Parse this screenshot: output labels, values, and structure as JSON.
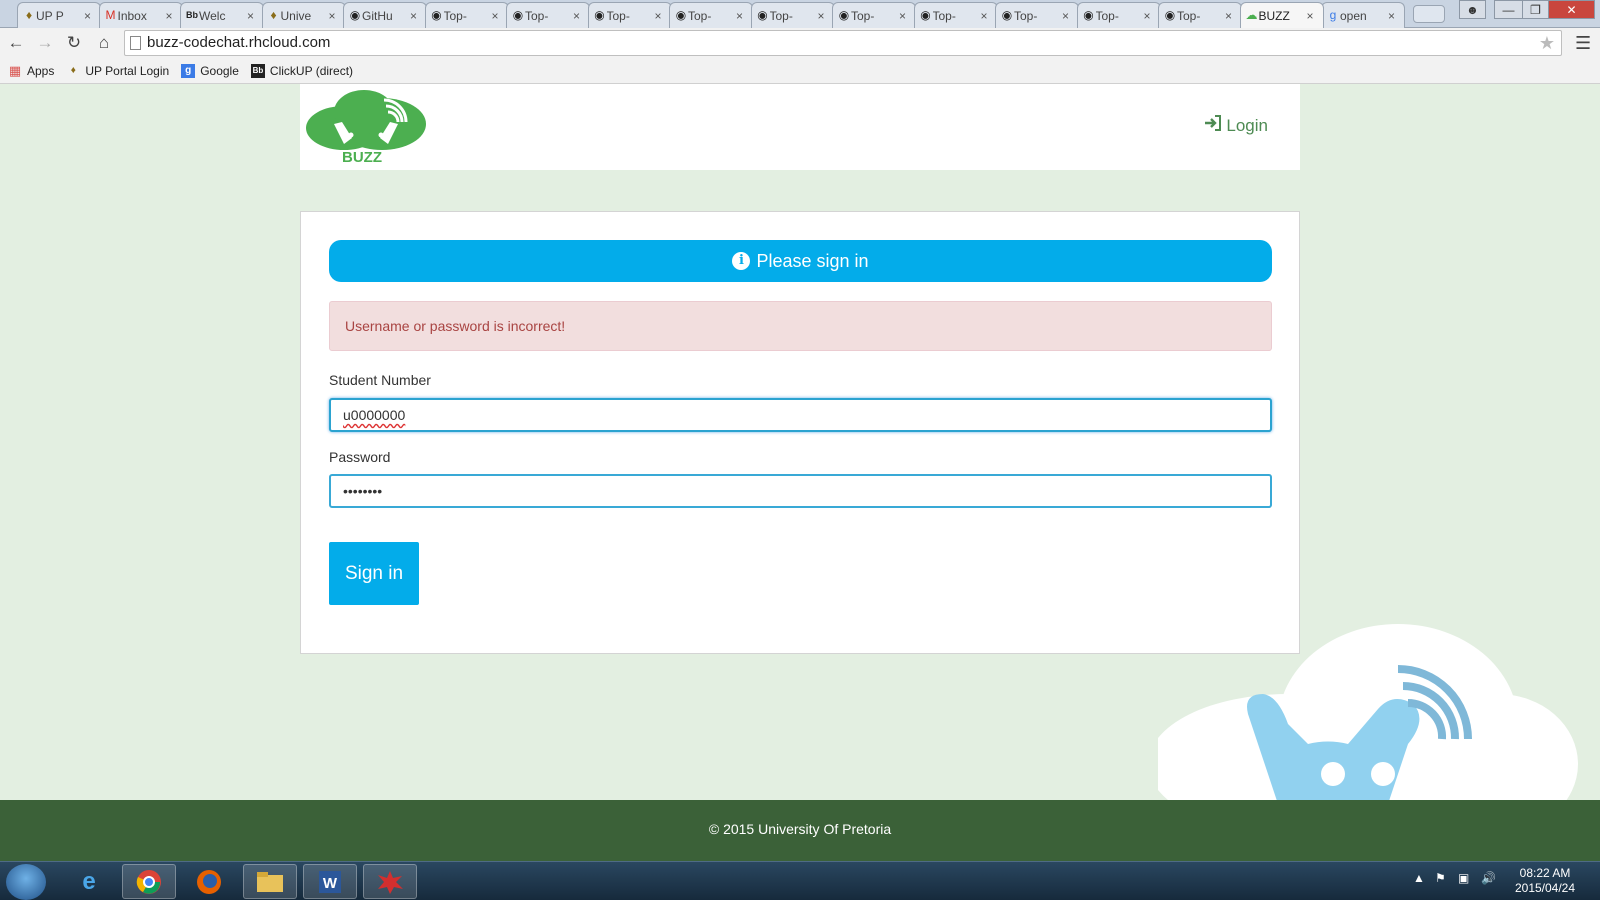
{
  "browser": {
    "tabs": [
      {
        "label": "UP P",
        "icon": "up-crest-icon"
      },
      {
        "label": "Inbox",
        "icon": "gmail-icon"
      },
      {
        "label": "Welc",
        "icon": "blackboard-icon"
      },
      {
        "label": "Unive",
        "icon": "up-crest-icon"
      },
      {
        "label": "GitHu",
        "icon": "github-icon"
      },
      {
        "label": "Top-",
        "icon": "github-icon"
      },
      {
        "label": "Top-",
        "icon": "github-icon"
      },
      {
        "label": "Top-",
        "icon": "github-icon"
      },
      {
        "label": "Top-",
        "icon": "github-icon"
      },
      {
        "label": "Top-",
        "icon": "github-icon"
      },
      {
        "label": "Top-",
        "icon": "github-icon"
      },
      {
        "label": "Top-",
        "icon": "github-icon"
      },
      {
        "label": "Top-",
        "icon": "github-icon"
      },
      {
        "label": "Top-",
        "icon": "github-icon"
      },
      {
        "label": "Top-",
        "icon": "github-icon"
      },
      {
        "label": "BUZZ",
        "icon": "buzz-icon",
        "active": true
      },
      {
        "label": "open",
        "icon": "google-icon"
      }
    ],
    "close_glyph": "×",
    "url": "buzz-codechat.rhcloud.com",
    "bookmarks": [
      {
        "label": "Apps",
        "icon": "apps-grid-icon"
      },
      {
        "label": "UP Portal Login",
        "icon": "up-crest-icon"
      },
      {
        "label": "Google",
        "icon": "google-icon"
      },
      {
        "label": "ClickUP (direct)",
        "icon": "blackboard-icon"
      }
    ]
  },
  "header": {
    "logo_text": "BUZZ",
    "login_label": "Login"
  },
  "form": {
    "banner_text": "Please sign in",
    "error_text": "Username or password is incorrect!",
    "student_number_label": "Student Number",
    "student_number_value": "u0000000",
    "password_label": "Password",
    "password_value": "••••••••",
    "submit_label": "Sign in"
  },
  "footer": {
    "text": "© 2015 University Of Pretoria"
  },
  "taskbar": {
    "apps": [
      {
        "name": "internet-explorer",
        "icon": "internet-explorer-icon"
      },
      {
        "name": "chrome",
        "icon": "chrome-icon"
      },
      {
        "name": "firefox",
        "icon": "firefox-icon"
      },
      {
        "name": "file-explorer",
        "icon": "folder-icon"
      },
      {
        "name": "word",
        "icon": "word-icon"
      },
      {
        "name": "app",
        "icon": "red-splat-icon"
      }
    ],
    "clock_time": "08:22 AM",
    "clock_date": "2015/04/24"
  },
  "colors": {
    "accent": "#03acea",
    "brand_green": "#4caf50",
    "footer_bg": "#3b6138",
    "page_bg": "#e3efe1",
    "error_bg": "#f2dede",
    "error_text": "#a94442"
  }
}
